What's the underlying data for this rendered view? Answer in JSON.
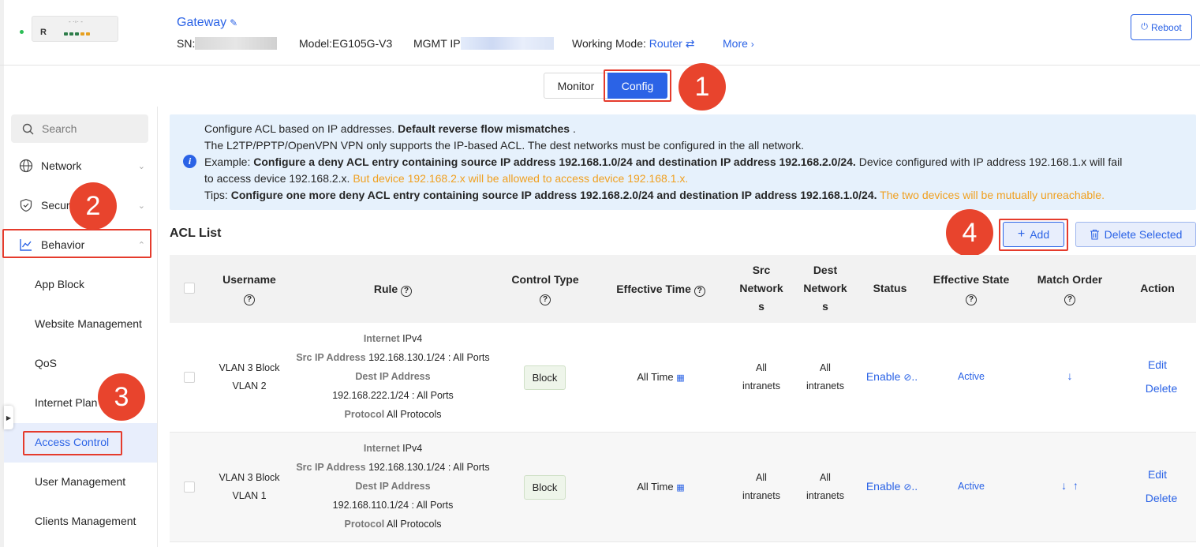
{
  "header": {
    "device_name": "Gateway",
    "sn_label": "SN:",
    "model": "Model:EG105G-V3",
    "mgmt_ip_label": "MGMT IP",
    "working_mode_label": "Working Mode:",
    "working_mode_value": "Router",
    "more_label": "More",
    "reboot_label": "Reboot",
    "device_badge_text": "R"
  },
  "tabs": {
    "monitor": "Monitor",
    "config": "Config"
  },
  "annotations": [
    "1",
    "2",
    "3",
    "4"
  ],
  "sidebar": {
    "search_placeholder": "Search",
    "items": [
      {
        "label": "Network"
      },
      {
        "label": "Security"
      },
      {
        "label": "Behavior"
      }
    ],
    "sub_items": [
      {
        "label": "App Block"
      },
      {
        "label": "Website Management"
      },
      {
        "label": "QoS"
      },
      {
        "label": "Internet Plan"
      },
      {
        "label": "Access Control"
      },
      {
        "label": "User Management"
      },
      {
        "label": "Clients Management"
      }
    ]
  },
  "notice": {
    "line1_a": "Configure ACL based on IP addresses.",
    "line1_b": "Default reverse flow mismatches",
    "line1_c": ".",
    "line2": "The L2TP/PPTP/OpenVPN VPN only supports the IP-based ACL. The dest networks must be configured in the all network.",
    "line3_a": "Example:",
    "line3_b": "Configure a deny ACL entry containing source IP address 192.168.1.0/24 and destination IP address 192.168.2.0/24.",
    "line3_c": "Device configured with IP address 192.168.1.x will fail",
    "line4_a": "to access device 192.168.2.x.",
    "line4_b": "But device 192.168.2.x will be allowed to access device 192.168.1.x.",
    "line5_a": "Tips:",
    "line5_b": "Configure one more deny ACL entry containing source IP address 192.168.2.0/24 and destination IP address 192.168.1.0/24.",
    "line5_c": "The two devices will be mutually unreachable."
  },
  "acl": {
    "title": "ACL List",
    "add_label": "Add",
    "delete_selected_label": "Delete Selected",
    "columns": {
      "username": "Username",
      "rule": "Rule",
      "control_type": "Control Type",
      "effective_time": "Effective Time",
      "src_networks_1": "Src",
      "src_networks_2": "Network",
      "src_networks_3": "s",
      "dest_networks_1": "Dest",
      "dest_networks_2": "Network",
      "dest_networks_3": "s",
      "status": "Status",
      "effective_state": "Effective State",
      "match_order": "Match Order",
      "action": "Action"
    },
    "rule_labels": {
      "internet": "Internet",
      "src_ip": "Src IP Address",
      "dest_ip": "Dest IP Address",
      "protocol": "Protocol"
    },
    "rows": [
      {
        "username_1": "VLAN 3 Block",
        "username_2": "VLAN 2",
        "ip_version": "IPv4",
        "src_ip": "192.168.130.1/24 : All Ports",
        "dest_ip": "192.168.222.1/24 : All Ports",
        "protocol": "All Protocols",
        "control_type": "Block",
        "effective_time": "All Time",
        "src_networks_1": "All",
        "src_networks_2": "intranets",
        "dest_networks_1": "All",
        "dest_networks_2": "intranets",
        "status": "Enable",
        "effective_state": "Active",
        "match_order": "↓",
        "edit": "Edit",
        "delete": "Delete"
      },
      {
        "username_1": "VLAN 3 Block",
        "username_2": "VLAN 1",
        "ip_version": "IPv4",
        "src_ip": "192.168.130.1/24 : All Ports",
        "dest_ip": "192.168.110.1/24 : All Ports",
        "protocol": "All Protocols",
        "control_type": "Block",
        "effective_time": "All Time",
        "src_networks_1": "All",
        "src_networks_2": "intranets",
        "dest_networks_1": "All",
        "dest_networks_2": "intranets",
        "status": "Enable",
        "effective_state": "Active",
        "match_order": "↓  ↑",
        "edit": "Edit",
        "delete": "Delete"
      }
    ]
  },
  "colors": {
    "accent": "#2b63e6",
    "annotation_red": "#e8442d",
    "notice_bg": "#e6f1fc",
    "warning_orange": "#f0a020"
  }
}
